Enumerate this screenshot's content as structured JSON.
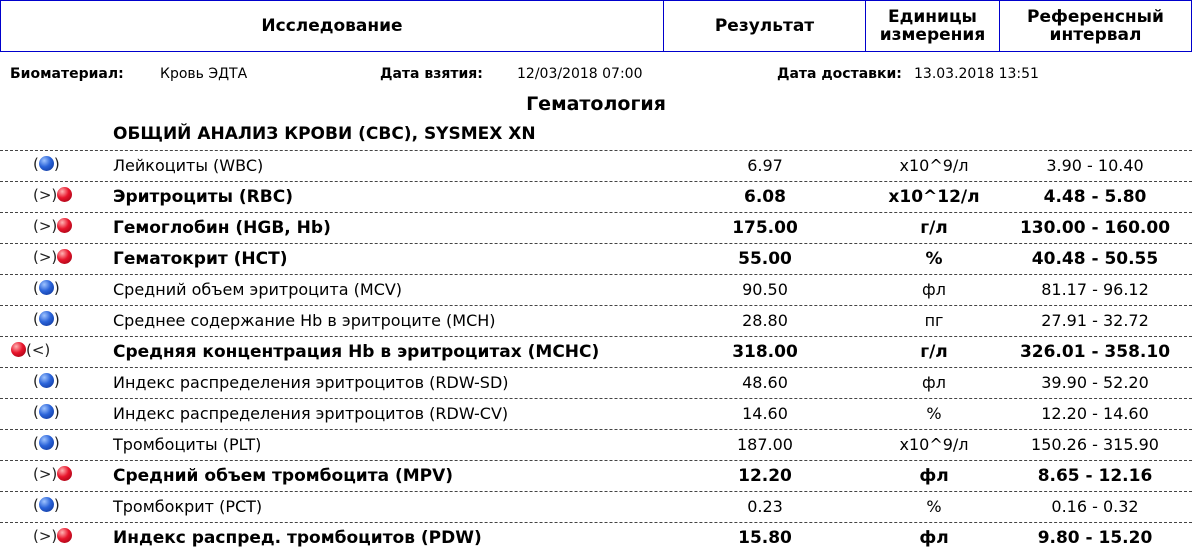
{
  "header": {
    "study": "Исследование",
    "result": "Результат",
    "units": "Единицы\nизмерения",
    "reference": "Референсный\nинтервал"
  },
  "meta": {
    "biomaterial_label": "Биоматериал:",
    "biomaterial_value": "Кровь ЭДТА",
    "taken_label": "Дата взятия:",
    "taken_value": "12/03/2018 07:00",
    "delivery_label": "Дата доставки:",
    "delivery_value": "13.03.2018 13:51"
  },
  "section_title": "Гематология",
  "panel_title": "ОБЩИЙ АНАЛИЗ КРОВИ (CBC), SYSMEX XN",
  "colors": {
    "normal": "#2a63d9",
    "abnormal": "#e8142b",
    "border": "#0000cc"
  },
  "rows": [
    {
      "flag": "normal",
      "marker": "",
      "name": "Лейкоциты (WBC)",
      "result": "6.97",
      "unit": "x10^9/л",
      "ref": "3.90 - 10.40"
    },
    {
      "flag": "high",
      "marker": ">",
      "name": "Эритроциты (RBC)",
      "result": "6.08",
      "unit": "x10^12/л",
      "ref": "4.48 - 5.80"
    },
    {
      "flag": "high",
      "marker": ">",
      "name": "Гемоглобин (HGB, Hb)",
      "result": "175.00",
      "unit": "г/л",
      "ref": "130.00 - 160.00"
    },
    {
      "flag": "high",
      "marker": ">",
      "name": "Гематокрит (HCT)",
      "result": "55.00",
      "unit": "%",
      "ref": "40.48 - 50.55"
    },
    {
      "flag": "normal",
      "marker": "",
      "name": "Средний объем эритроцита (MCV)",
      "result": "90.50",
      "unit": "фл",
      "ref": "81.17 - 96.12"
    },
    {
      "flag": "normal",
      "marker": "",
      "name": "Среднее содержание Hb в эритроците (MCH)",
      "result": "28.80",
      "unit": "пг",
      "ref": "27.91 - 32.72"
    },
    {
      "flag": "low",
      "marker": "<",
      "name": "Средняя концентрация Hb в эритроцитах (MCHC)",
      "result": "318.00",
      "unit": "г/л",
      "ref": "326.01 - 358.10"
    },
    {
      "flag": "normal",
      "marker": "",
      "name": "Индекс распределения эритроцитов (RDW-SD)",
      "result": "48.60",
      "unit": "фл",
      "ref": "39.90 - 52.20"
    },
    {
      "flag": "normal",
      "marker": "",
      "name": "Индекс распределения эритроцитов (RDW-CV)",
      "result": "14.60",
      "unit": "%",
      "ref": "12.20 - 14.60"
    },
    {
      "flag": "normal",
      "marker": "",
      "name": "Тромбоциты (PLT)",
      "result": "187.00",
      "unit": "x10^9/л",
      "ref": "150.26 - 315.90"
    },
    {
      "flag": "high",
      "marker": ">",
      "name": "Средний объем тромбоцита (MPV)",
      "result": "12.20",
      "unit": "фл",
      "ref": "8.65 - 12.16"
    },
    {
      "flag": "normal",
      "marker": "",
      "name": "Тромбокрит (PCT)",
      "result": "0.23",
      "unit": "%",
      "ref": "0.16 - 0.32"
    },
    {
      "flag": "high",
      "marker": ">",
      "name": "Индекс распред. тромбоцитов (PDW)",
      "result": "15.80",
      "unit": "фл",
      "ref": "9.80 - 15.20"
    }
  ]
}
